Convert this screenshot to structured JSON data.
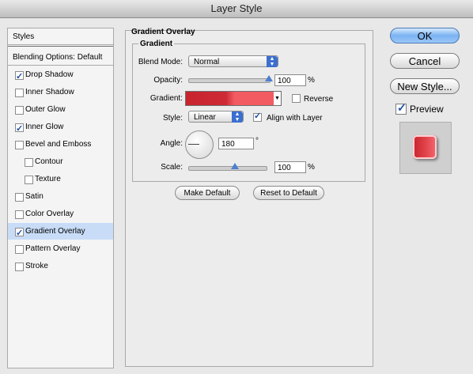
{
  "window": {
    "title": "Layer Style"
  },
  "sidebar": {
    "header": "Styles",
    "blending": "Blending Options: Default",
    "items": [
      {
        "label": "Drop Shadow",
        "checked": true
      },
      {
        "label": "Inner Shadow",
        "checked": false
      },
      {
        "label": "Outer Glow",
        "checked": false
      },
      {
        "label": "Inner Glow",
        "checked": true
      },
      {
        "label": "Bevel and Emboss",
        "checked": false
      },
      {
        "label": "Contour",
        "checked": false
      },
      {
        "label": "Texture",
        "checked": false
      },
      {
        "label": "Satin",
        "checked": false
      },
      {
        "label": "Color Overlay",
        "checked": false
      },
      {
        "label": "Gradient Overlay",
        "checked": true,
        "selected": true
      },
      {
        "label": "Pattern Overlay",
        "checked": false
      },
      {
        "label": "Stroke",
        "checked": false
      }
    ]
  },
  "panel": {
    "title": "Gradient Overlay",
    "group_title": "Gradient",
    "blend_mode": {
      "label": "Blend Mode:",
      "value": "Normal"
    },
    "opacity": {
      "label": "Opacity:",
      "value": "100",
      "unit": "%",
      "level": 1.0
    },
    "gradient": {
      "label": "Gradient:",
      "colors": [
        "#c8242e",
        "#f25b62"
      ]
    },
    "reverse": {
      "label": "Reverse",
      "checked": false
    },
    "style": {
      "label": "Style:",
      "value": "Linear"
    },
    "align": {
      "label": "Align with Layer",
      "checked": true
    },
    "angle": {
      "label": "Angle:",
      "value": "180",
      "unit": "°"
    },
    "scale": {
      "label": "Scale:",
      "value": "100",
      "unit": "%",
      "level": 0.6
    },
    "make_default": "Make Default",
    "reset_default": "Reset to Default"
  },
  "actions": {
    "ok": "OK",
    "cancel": "Cancel",
    "new_style": "New Style...",
    "preview_label": "Preview",
    "preview_checked": true
  }
}
